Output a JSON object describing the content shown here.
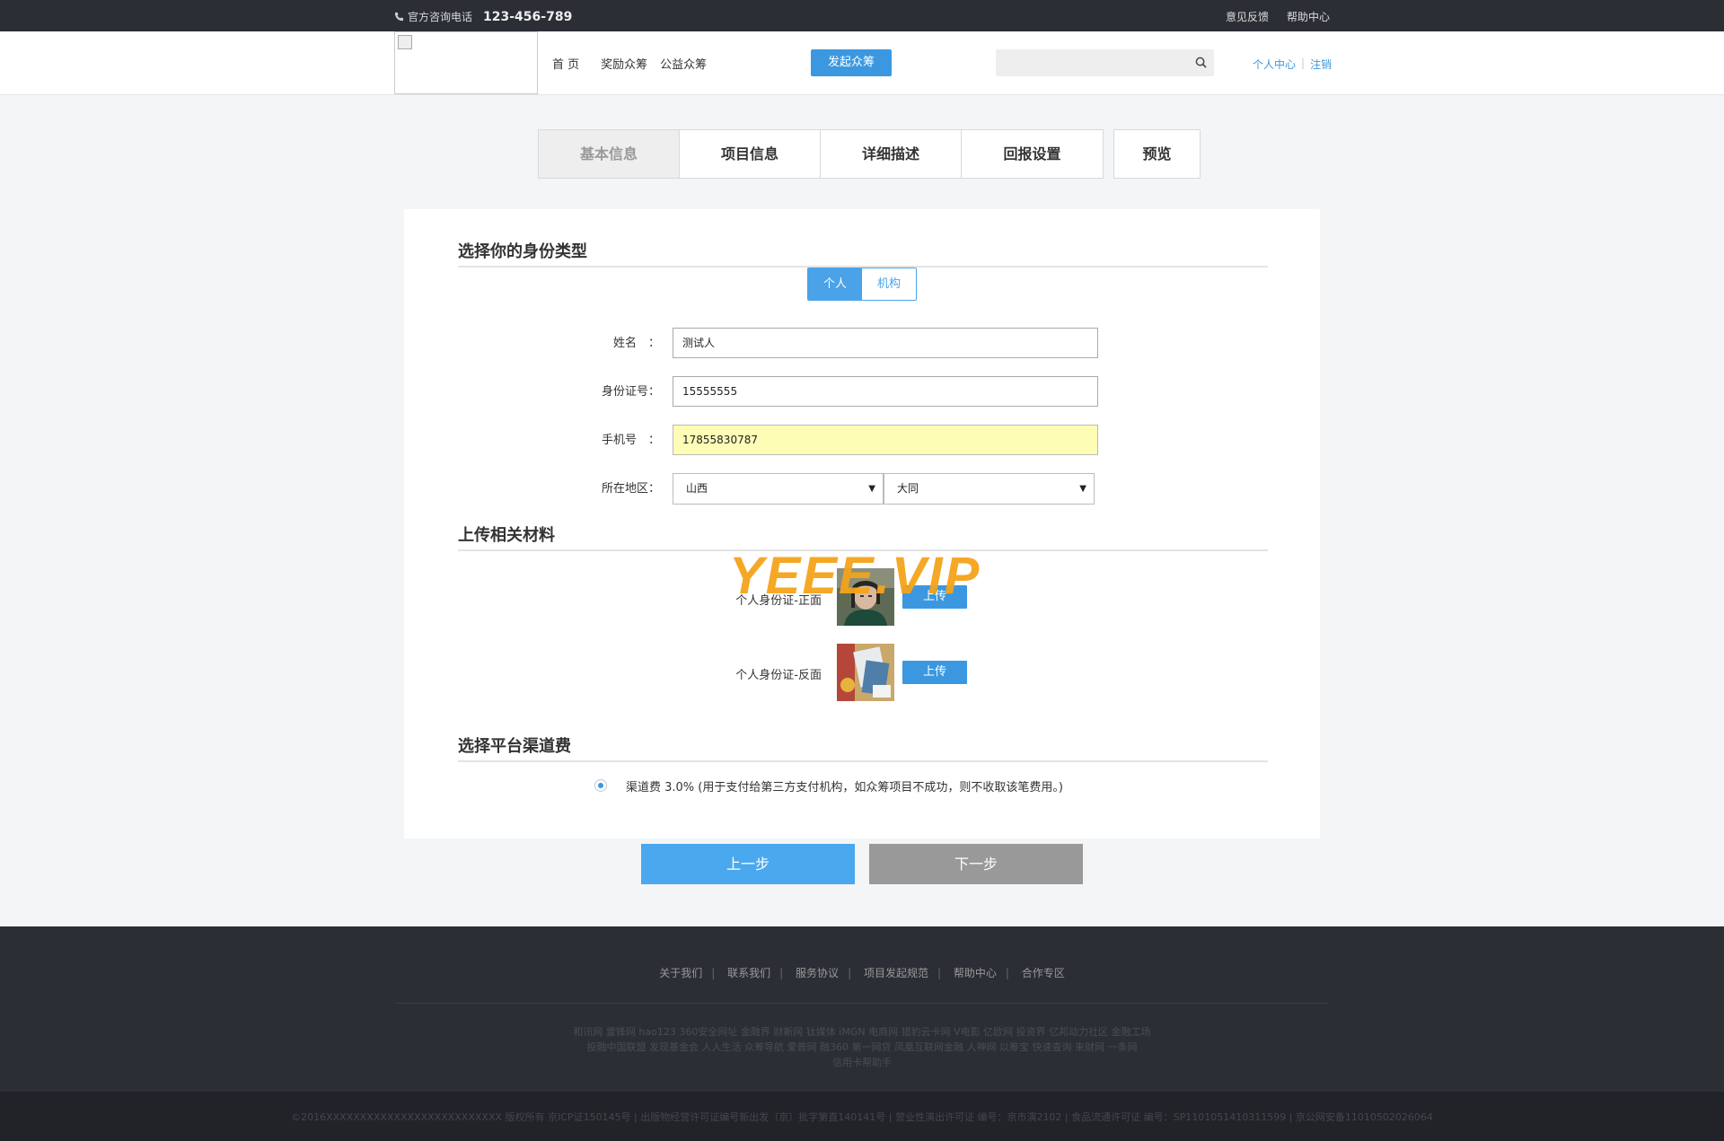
{
  "topbar": {
    "phone_label": "官方咨询电话",
    "phone_number": "123-456-789",
    "links": [
      "意见反馈",
      "帮助中心"
    ]
  },
  "header": {
    "nav": [
      "首 页",
      "奖励众筹",
      "公益众筹"
    ],
    "launch_label": "发起众筹",
    "search_placeholder": "",
    "user_center": "个人中心",
    "logout": "注销"
  },
  "steps": [
    "基本信息",
    "项目信息",
    "详细描述",
    "回报设置"
  ],
  "preview_label": "预览",
  "identity": {
    "title": "选择你的身份类型",
    "types": [
      "个人",
      "机构"
    ]
  },
  "form": {
    "name_label": "姓名　：",
    "name_value": "测试人",
    "id_label": "身份证号：",
    "id_value": "15555555",
    "phone_label": "手机号　：",
    "phone_value": "17855830787",
    "region_label": "所在地区：",
    "province": "山西",
    "city": "大同"
  },
  "upload": {
    "title": "上传相关材料",
    "front_label": "个人身份证-正面",
    "back_label": "个人身份证-反面",
    "button": "上传"
  },
  "fee": {
    "title": "选择平台渠道费",
    "text": "渠道费 3.0% (用于支付给第三方支付机构，如众筹项目不成功，则不收取该笔费用。)"
  },
  "watermark": "YEEE.VIP",
  "buttons": {
    "prev": "上一步",
    "next": "下一步"
  },
  "footer": {
    "links": [
      "关于我们",
      "联系我们",
      "服务协议",
      "项目发起规范",
      "帮助中心",
      "合作专区"
    ],
    "friend_links_1": "和讯网 雷锋网 hao123 360安全网址 金融界 财新网 钛媒体 iMGN 电商网 猎豹云卡网 V电影 亿欧网 投资界 亿邦动力社区 金融工场",
    "friend_links_2": "投融中国联盟 发现基金会 人人生活 众筹导航 爱普网 融360 第一网贷 凤凰互联网金融 人神网 以筹宝 快速查询 来财网 一条网",
    "friend_links_3": "信用卡帮助手",
    "copyright": "©2016XXXXXXXXXXXXXXXXXXXXXXXXXX 版权所有 京ICP证150145号 | 出版物经营许可证编号新出发（京）批字第直140141号 | 营业性演出许可证 编号：京市演2102 | 食品流通许可证 编号：SP1101051410311599 | 京公网安备11010502026064"
  },
  "colors": {
    "accent": "#3b98e0",
    "dark_bar": "#2b2e35",
    "watermark": "#f5a41b",
    "highlight_input": "#fdfdb6"
  }
}
